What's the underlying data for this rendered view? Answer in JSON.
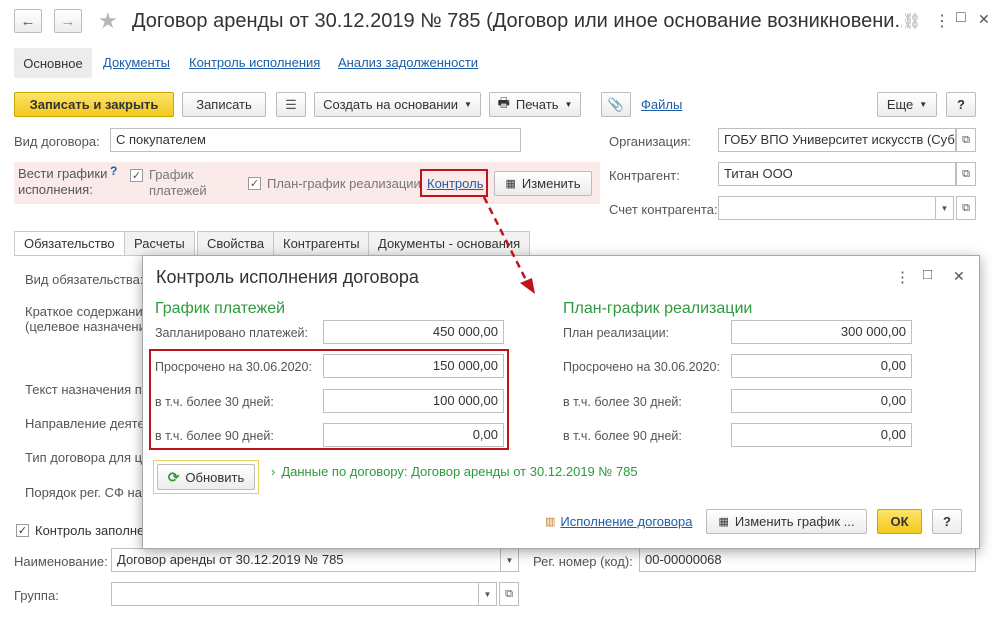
{
  "window": {
    "title": "Договор аренды от 30.12.2019 № 785 (Договор или иное основание возникновени...",
    "nav_back": "←",
    "nav_forward": "→",
    "star": "★",
    "link_icon": "🔗",
    "more_icon": "⋮",
    "max_icon": "□",
    "close_icon": "✕"
  },
  "nav_tabs": [
    "Основное",
    "Документы",
    "Контроль исполнения",
    "Анализ задолженности"
  ],
  "toolbar": {
    "save_close": "Записать и закрыть",
    "save": "Записать",
    "create_based": "Создать на основании",
    "print": "Печать",
    "files": "Файлы",
    "more": "Еще",
    "help": "?"
  },
  "form": {
    "contract_kind_label": "Вид договора:",
    "contract_kind_value": "С покупателем",
    "schedules_label": "Вести графики исполнения:",
    "schedules_help": "?",
    "payment_schedule_label": "График платежей",
    "realization_plan_label": "План-график реализации",
    "control_link": "Контроль",
    "change_button": "Изменить",
    "organization_label": "Организация:",
    "organization_value": "ГОБУ ВПО Университет искусств (Суб",
    "counterparty_label": "Контрагент:",
    "counterparty_value": "Титан ООО",
    "account_label": "Счет контрагента:",
    "account_value": ""
  },
  "inner_tabs": [
    "Обязательство",
    "Расчеты",
    "Свойства",
    "Контрагенты",
    "Документы - основания"
  ],
  "obligation_labels": [
    "Вид обязательства:",
    "Краткое содержани",
    "(целевое назначени",
    "Текст назначения п",
    "Направление деяте",
    "Тип договора для ц",
    "Порядок рег. СФ на"
  ],
  "bottom": {
    "control_fill_label": "Контроль заполне",
    "name_label": "Наименование:",
    "name_value": "Договор аренды от 30.12.2019 № 785",
    "reg_number_label": "Рег. номер (код):",
    "reg_number_value": "00-00000068",
    "group_label": "Группа:",
    "group_value": ""
  },
  "dialog": {
    "title": "Контроль исполнения договора",
    "more_icon": "⋮",
    "max_icon": "□",
    "close_icon": "✕",
    "payments": {
      "heading": "График платежей",
      "rows": [
        {
          "label": "Запланировано платежей:",
          "value": "450 000,00"
        },
        {
          "label": "Просрочено на 30.06.2020:",
          "value": "150 000,00"
        },
        {
          "label": "в т.ч. более 30 дней:",
          "value": "100 000,00"
        },
        {
          "label": "в т.ч. более 90 дней:",
          "value": "0,00"
        }
      ]
    },
    "realization": {
      "heading": "План-график реализации",
      "rows": [
        {
          "label": "План реализации:",
          "value": "300 000,00"
        },
        {
          "label": "Просрочено на 30.06.2020:",
          "value": "0,00"
        },
        {
          "label": "в т.ч. более 30 дней:",
          "value": "0,00"
        },
        {
          "label": "в т.ч. более 90 дней:",
          "value": "0,00"
        }
      ]
    },
    "refresh_button": "Обновить",
    "contract_data_link": "Данные по договору: Договор аренды от 30.12.2019 № 785",
    "execution_link": "Исполнение договора",
    "change_schedule_button": "Изменить график ...",
    "ok_button": "ОК",
    "help_button": "?"
  },
  "colors": {
    "accent_yellow": "#f3c91c",
    "highlight_red": "#c0141c",
    "heading_green": "#2e9a3c",
    "link_blue": "#1c5ea8",
    "pink_row": "#fbeaea"
  }
}
